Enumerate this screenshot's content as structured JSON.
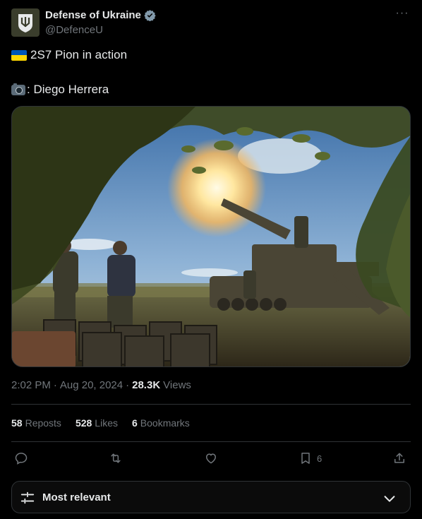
{
  "account": {
    "display_name": "Defense of Ukraine",
    "handle": "@DefenceU",
    "verified": true
  },
  "tweet": {
    "line1": "2S7 Pion in action",
    "line2": ": Diego Herrera",
    "line1_icon": "ukraine-flag-icon",
    "line2_icon": "camera-icon"
  },
  "meta": {
    "time": "2:02 PM",
    "date": "Aug 20, 2024",
    "views_count": "28.3K",
    "views_label": "Views"
  },
  "stats": {
    "reposts_count": "58",
    "reposts_label": "Reposts",
    "likes_count": "528",
    "likes_label": "Likes",
    "bookmarks_count": "6",
    "bookmarks_label": "Bookmarks"
  },
  "actions": {
    "bookmark_count": "6"
  },
  "sort": {
    "label": "Most relevant"
  },
  "colors": {
    "background": "#000000",
    "text_primary": "#e7e9ea",
    "text_secondary": "#71767b",
    "verified_badge": "#829aab",
    "divider": "#2f3336"
  }
}
